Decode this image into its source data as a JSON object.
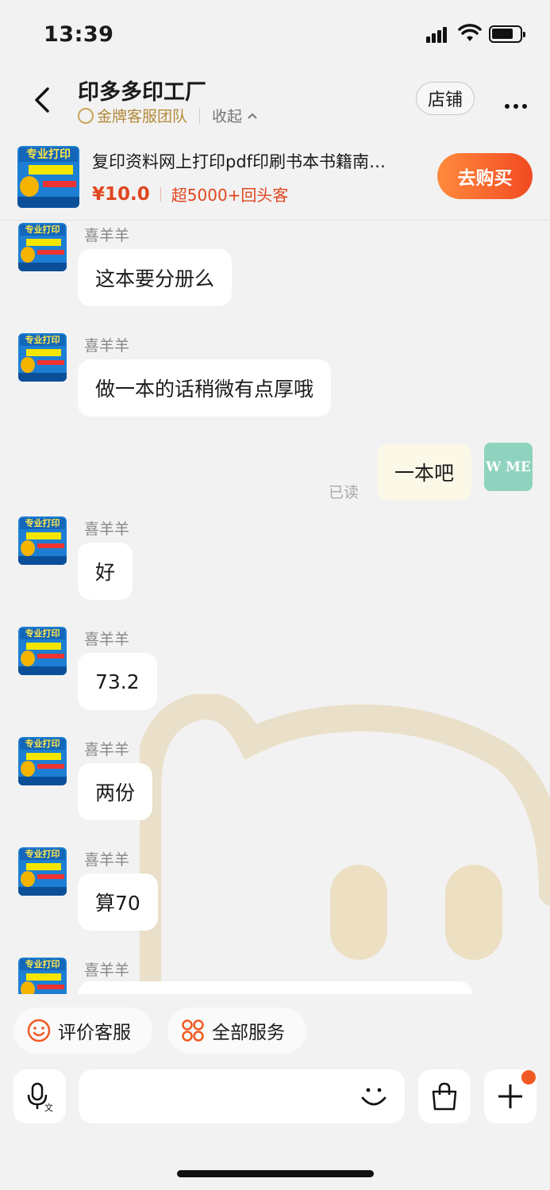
{
  "status": {
    "time": "13:39"
  },
  "header": {
    "shop_name": "印多多印工厂",
    "team_label": "金牌客服团队",
    "collapse_label": "收起",
    "store_button": "店铺"
  },
  "product": {
    "title": "复印资料网上打印pdf印刷书本书籍南…",
    "price": "¥10.0",
    "repeat_buyers": "超5000+回头客",
    "buy_button": "去购买",
    "image_text": "专业打印"
  },
  "messages": [
    {
      "sender": "喜羊羊",
      "text": "这本要分册么",
      "side": "left"
    },
    {
      "sender": "喜羊羊",
      "text": "做一本的话稍微有点厚哦",
      "side": "left"
    },
    {
      "sender": "",
      "text": "一本吧",
      "side": "right",
      "read_label": "已读"
    },
    {
      "sender": "喜羊羊",
      "text": "好",
      "side": "left"
    },
    {
      "sender": "喜羊羊",
      "text": "73.2",
      "side": "left"
    },
    {
      "sender": "喜羊羊",
      "text": "两份",
      "side": "left"
    },
    {
      "sender": "喜羊羊",
      "text": "算70",
      "side": "left"
    },
    {
      "sender": "喜羊羊",
      "text": "",
      "side": "left"
    }
  ],
  "my_avatar_text": "W ME",
  "bottom": {
    "chip_rate": "评价客服",
    "chip_services": "全部服务"
  },
  "colors": {
    "accent": "#f14a22",
    "bubble_mine": "#fcf8e8"
  }
}
